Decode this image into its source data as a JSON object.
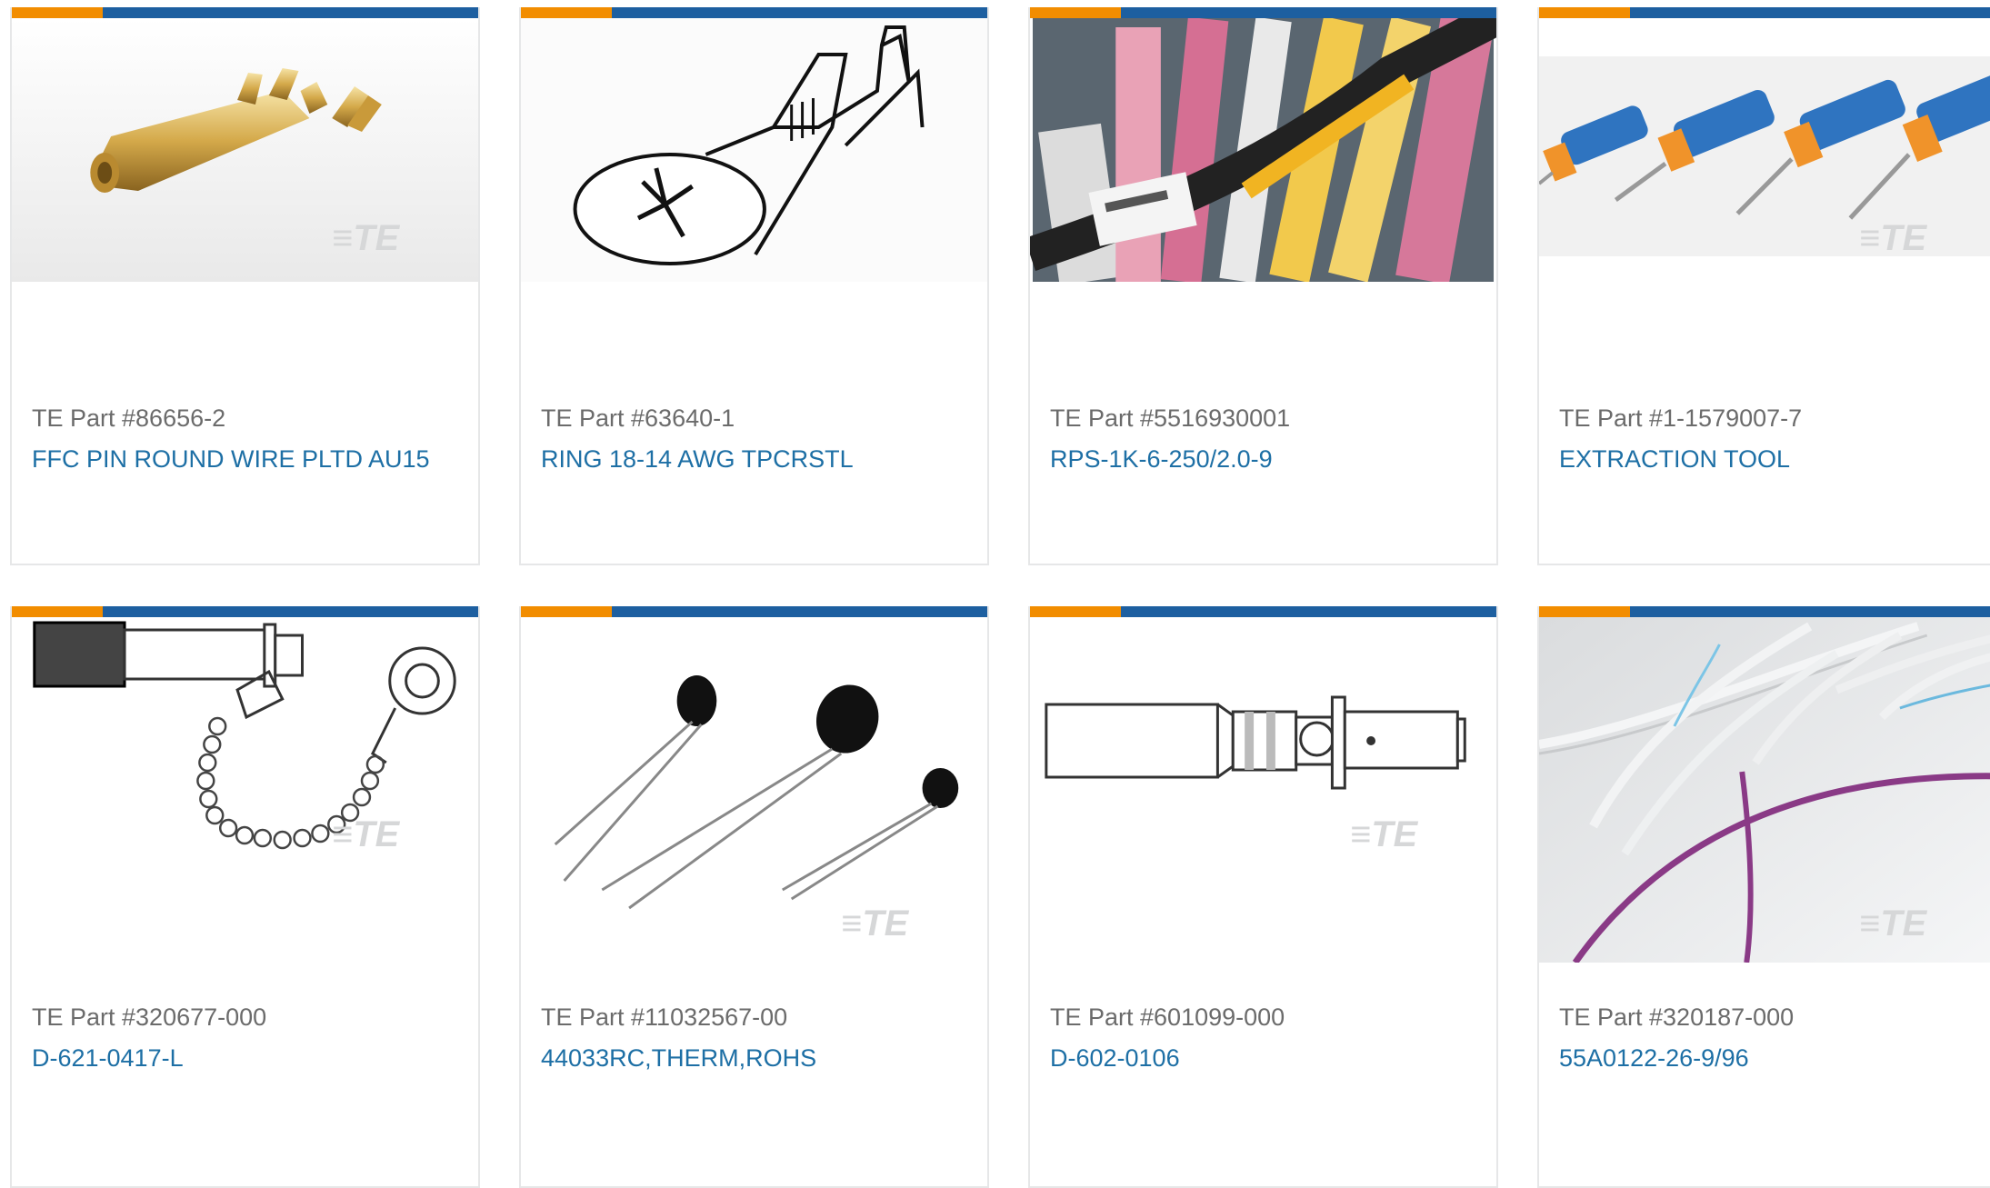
{
  "colors": {
    "accent_orange": "#f28d00",
    "accent_blue": "#1d5fa0",
    "part_number_text": "#6b6b6b",
    "description_link": "#1d6fa5",
    "card_border": "#e6e7e8",
    "watermark": "#d6d7d8"
  },
  "watermark_text": "TE",
  "products": [
    {
      "part_number": "TE Part #86656-2",
      "description": "FFC PIN ROUND WIRE PLTD AU15",
      "image_icon": "gold-pin-terminal-icon"
    },
    {
      "part_number": "TE Part #63640-1",
      "description": "RING 18-14 AWG TPCRSTL",
      "image_icon": "ring-terminal-drawing-icon"
    },
    {
      "part_number": "TE Part #5516930001",
      "description": "RPS-1K-6-250/2.0-9",
      "image_icon": "wire-marker-sleeves-icon"
    },
    {
      "part_number": "TE Part #1-1579007-7",
      "description": "EXTRACTION TOOL",
      "image_icon": "extraction-tools-icon"
    },
    {
      "part_number": "TE Part #320677-000",
      "description": "D-621-0417-L",
      "image_icon": "dust-cap-chain-drawing-icon"
    },
    {
      "part_number": "TE Part #11032567-00",
      "description": "44033RC,THERM,ROHS",
      "image_icon": "thermistors-icon"
    },
    {
      "part_number": "TE Part #601099-000",
      "description": "D-602-0106",
      "image_icon": "solder-sleeve-drawing-icon"
    },
    {
      "part_number": "TE Part #320187-000",
      "description": "55A0122-26-9/96",
      "image_icon": "wires-cables-icon"
    }
  ]
}
